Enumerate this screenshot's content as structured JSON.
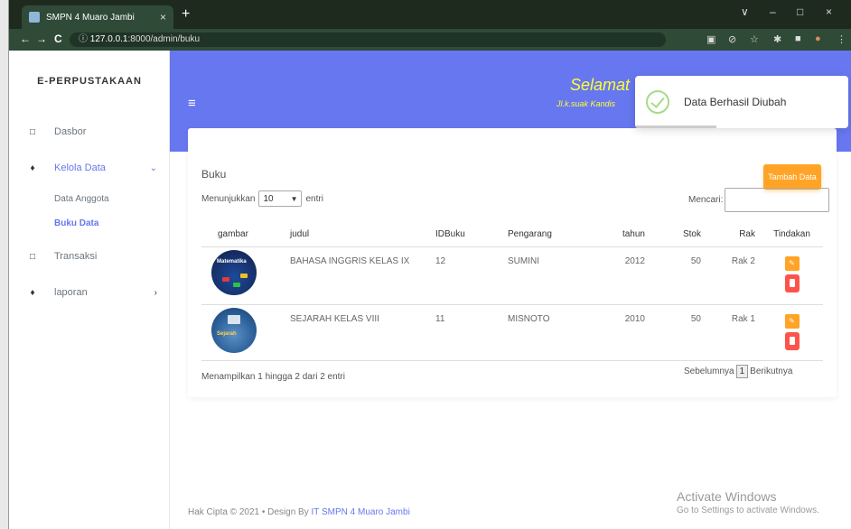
{
  "browser": {
    "tab_title": "SMPN 4 Muaro Jambi",
    "tab_close": "×",
    "new_tab": "+",
    "url_host": "127.0.0.1",
    "url_path": ":8000/admin/buku",
    "info_icon": "ⓘ",
    "window_controls": [
      "∨",
      "–",
      "□",
      "×"
    ],
    "nav": {
      "back": "←",
      "forward": "→",
      "reload": "C"
    },
    "extensions": [
      "▣",
      "⊘",
      "☆",
      "✱",
      "■",
      "●",
      "⋮"
    ]
  },
  "sidebar": {
    "brand": "E-PERPUSTAKAAN",
    "items": [
      {
        "label": "Dasbor",
        "icon": "□"
      },
      {
        "label": "Kelola Data",
        "icon": "♦",
        "chevron": "⌄"
      },
      {
        "label": "Transaksi",
        "icon": "□"
      },
      {
        "label": "laporan",
        "icon": "♦",
        "chevron": "›"
      }
    ],
    "subitems": [
      "Data Anggota",
      "Buku Data"
    ]
  },
  "topnav": {
    "burger": "≡",
    "welcome": "Selamat",
    "subwelcome": "Jl.k.suak Kandis"
  },
  "toast": {
    "message": "Data Berhasil Diubah"
  },
  "card": {
    "title": "Buku",
    "add_button": "Tambah Data",
    "show_prefix": "Menunjukkan",
    "show_value": "10",
    "show_suffix": "entri",
    "search_label": "Mencari:",
    "columns": [
      "gambar",
      "judul",
      "IDBuku",
      "Pengarang",
      "tahun",
      "Stok",
      "Rak",
      "Tindakan"
    ],
    "rows": [
      {
        "judul": "BAHASA INGGRIS KELAS IX",
        "id": "12",
        "pengarang": "SUMINI",
        "tahun": "2012",
        "stok": "50",
        "rak": "Rak 2",
        "cover_label": "Matematika"
      },
      {
        "judul": "SEJARAH KELAS VIII",
        "id": "11",
        "pengarang": "MISNOTO",
        "tahun": "2010",
        "stok": "50",
        "rak": "Rak 1",
        "cover_label": "Sejarah"
      }
    ],
    "info": "Menampilkan 1 hingga 2 dari 2 entri",
    "pager": {
      "prev": "Sebelumnya",
      "page": "1",
      "next": "Berikutnya"
    }
  },
  "footer": {
    "text": "Hak Cipta © 2021  • Design By ",
    "link": "IT SMPN 4 Muaro Jambi"
  },
  "watermark": {
    "line1": "Activate Windows",
    "line2": "Go to Settings to activate Windows."
  },
  "colors": {
    "primary": "#6777ef",
    "warning": "#ffa426",
    "danger": "#fc544b",
    "welcome": "#ffff33"
  }
}
